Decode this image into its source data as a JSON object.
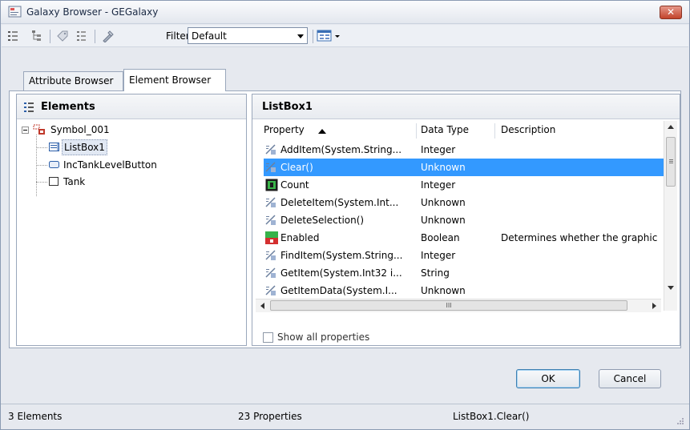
{
  "window": {
    "title": "Galaxy Browser - GEGalaxy",
    "close_label": "✕"
  },
  "toolbar": {
    "filter_label": "Filter:",
    "filter_value": "Default"
  },
  "tabs": [
    {
      "label": "Attribute Browser",
      "active": false
    },
    {
      "label": "Element Browser",
      "active": true
    }
  ],
  "elements_pane": {
    "title": "Elements",
    "tree": {
      "root": "Symbol_001",
      "children": [
        "ListBox1",
        "IncTankLevelButton",
        "Tank"
      ]
    }
  },
  "properties_pane": {
    "title": "ListBox1",
    "columns": [
      "Property",
      "Data Type",
      "Description"
    ],
    "rows": [
      {
        "property": "AddItem(System.String...",
        "type": "Integer",
        "description": "",
        "icon": "method-icon"
      },
      {
        "property": "Clear()",
        "type": "Unknown",
        "description": "",
        "icon": "method-icon"
      },
      {
        "property": "Count",
        "type": "Integer",
        "description": "",
        "icon": "property-icon"
      },
      {
        "property": "DeleteItem(System.Int...",
        "type": "Unknown",
        "description": "",
        "icon": "method-icon"
      },
      {
        "property": "DeleteSelection()",
        "type": "Unknown",
        "description": "",
        "icon": "method-icon"
      },
      {
        "property": "Enabled",
        "type": "Boolean",
        "description": "Determines whether the graphic",
        "icon": "boolean-property-icon"
      },
      {
        "property": "FindItem(System.String...",
        "type": "Integer",
        "description": "",
        "icon": "method-icon"
      },
      {
        "property": "GetItem(System.Int32 i...",
        "type": "String",
        "description": "",
        "icon": "method-icon"
      },
      {
        "property": "GetItemData(System.I...",
        "type": "Unknown",
        "description": "",
        "icon": "method-icon"
      }
    ],
    "selected_index": 1,
    "show_all_label": "Show all properties",
    "scroll_thumb_glyph": "III"
  },
  "buttons": {
    "ok": "OK",
    "cancel": "Cancel"
  },
  "status": {
    "elements_count": "3 Elements",
    "properties_count": "23 Properties",
    "selection": "ListBox1.Clear()"
  },
  "colors": {
    "selection": "#3399ff",
    "window_bg": "#e6e9ef",
    "close_button": "#c2432b"
  }
}
